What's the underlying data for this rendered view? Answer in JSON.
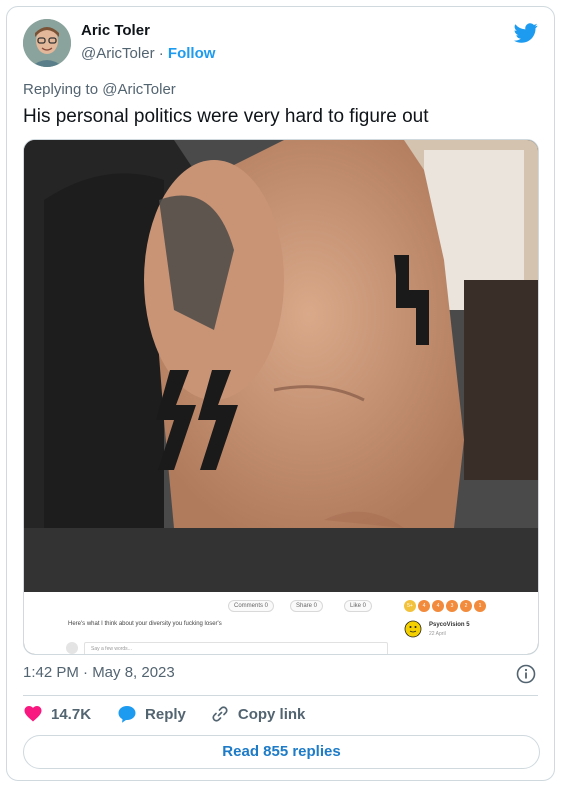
{
  "author": {
    "name": "Aric Toler",
    "handle": "@AricToler",
    "separator": "·",
    "follow_label": "Follow"
  },
  "tweet": {
    "replying_to": "Replying to @AricToler",
    "text": "His personal politics were very hard to figure out"
  },
  "media_screenshot": {
    "pills": [
      "Comments  0",
      "Share  0",
      "Like  0"
    ],
    "comment_text": "Here's what I think about your diversity you fucking loser's",
    "input_placeholder": "Say a few words...",
    "rating_labels": [
      "5+",
      "4",
      "4",
      "3",
      "2",
      "1"
    ],
    "user_name": "PsycoVision 5",
    "user_date": "22 April"
  },
  "meta": {
    "timestamp": "1:42 PM · May 8, 2023"
  },
  "actions": {
    "likes_count": "14.7K",
    "reply_label": "Reply",
    "copy_link_label": "Copy link"
  },
  "footer": {
    "read_replies_label": "Read 855 replies"
  },
  "colors": {
    "twitter_blue": "#1d9bf0",
    "like_pink": "#f91880",
    "muted_gray": "#536471",
    "border": "#cfd9de"
  }
}
